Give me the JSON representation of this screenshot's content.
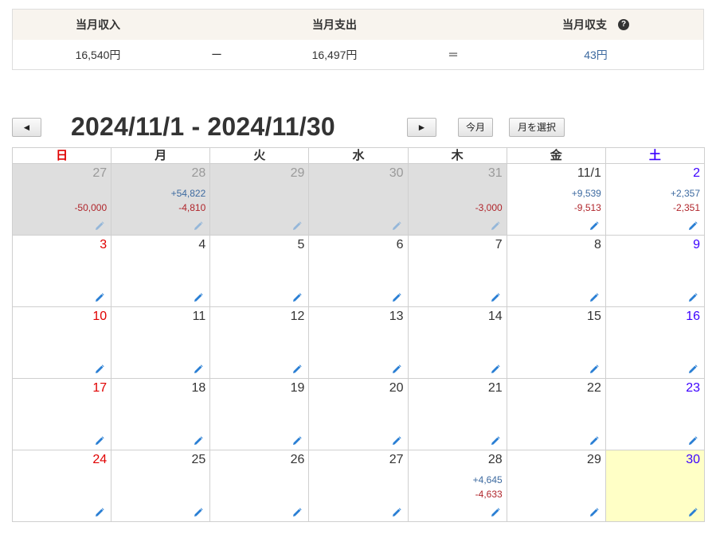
{
  "summary": {
    "headers": {
      "income": "当月収入",
      "expense": "当月支出",
      "net": "当月収支"
    },
    "help_icon": "question-circle-icon",
    "values": {
      "income": "16,540円",
      "minus": "ー",
      "expense": "16,497円",
      "equals": "＝",
      "net": "43円"
    }
  },
  "nav": {
    "prev": "◄",
    "range_title": "2024/11/1 - 2024/11/30",
    "next": "►",
    "this_month": "今月",
    "select_month": "月を選択"
  },
  "weekdays": [
    "日",
    "月",
    "火",
    "水",
    "木",
    "金",
    "土"
  ],
  "colors": {
    "sunday": "#e00000",
    "saturday": "#3b00ff",
    "income": "#3d6aa0",
    "expense": "#b0252b",
    "other_month_bg": "#dedede",
    "today_bg": "#ffffc6",
    "pencil": "#2a7fd4"
  },
  "edit_icon": "pencil-icon",
  "weeks": [
    [
      {
        "day": "27",
        "other": true,
        "income": "",
        "expense": "-50,000"
      },
      {
        "day": "28",
        "other": true,
        "income": "+54,822",
        "expense": "-4,810"
      },
      {
        "day": "29",
        "other": true,
        "income": "",
        "expense": ""
      },
      {
        "day": "30",
        "other": true,
        "income": "",
        "expense": ""
      },
      {
        "day": "31",
        "other": true,
        "income": "",
        "expense": "-3,000"
      },
      {
        "day": "11/1",
        "other": false,
        "income": "+9,539",
        "expense": "-9,513"
      },
      {
        "day": "2",
        "other": false,
        "income": "+2,357",
        "expense": "-2,351"
      }
    ],
    [
      {
        "day": "3",
        "income": "",
        "expense": ""
      },
      {
        "day": "4",
        "income": "",
        "expense": ""
      },
      {
        "day": "5",
        "income": "",
        "expense": ""
      },
      {
        "day": "6",
        "income": "",
        "expense": ""
      },
      {
        "day": "7",
        "income": "",
        "expense": ""
      },
      {
        "day": "8",
        "income": "",
        "expense": ""
      },
      {
        "day": "9",
        "income": "",
        "expense": ""
      }
    ],
    [
      {
        "day": "10",
        "income": "",
        "expense": ""
      },
      {
        "day": "11",
        "income": "",
        "expense": ""
      },
      {
        "day": "12",
        "income": "",
        "expense": ""
      },
      {
        "day": "13",
        "income": "",
        "expense": ""
      },
      {
        "day": "14",
        "income": "",
        "expense": ""
      },
      {
        "day": "15",
        "income": "",
        "expense": ""
      },
      {
        "day": "16",
        "income": "",
        "expense": ""
      }
    ],
    [
      {
        "day": "17",
        "income": "",
        "expense": ""
      },
      {
        "day": "18",
        "income": "",
        "expense": ""
      },
      {
        "day": "19",
        "income": "",
        "expense": ""
      },
      {
        "day": "20",
        "income": "",
        "expense": ""
      },
      {
        "day": "21",
        "income": "",
        "expense": ""
      },
      {
        "day": "22",
        "income": "",
        "expense": ""
      },
      {
        "day": "23",
        "income": "",
        "expense": ""
      }
    ],
    [
      {
        "day": "24",
        "income": "",
        "expense": ""
      },
      {
        "day": "25",
        "income": "",
        "expense": ""
      },
      {
        "day": "26",
        "income": "",
        "expense": ""
      },
      {
        "day": "27",
        "income": "",
        "expense": ""
      },
      {
        "day": "28",
        "income": "+4,645",
        "expense": "-4,633"
      },
      {
        "day": "29",
        "income": "",
        "expense": ""
      },
      {
        "day": "30",
        "today": true,
        "income": "",
        "expense": ""
      }
    ]
  ]
}
